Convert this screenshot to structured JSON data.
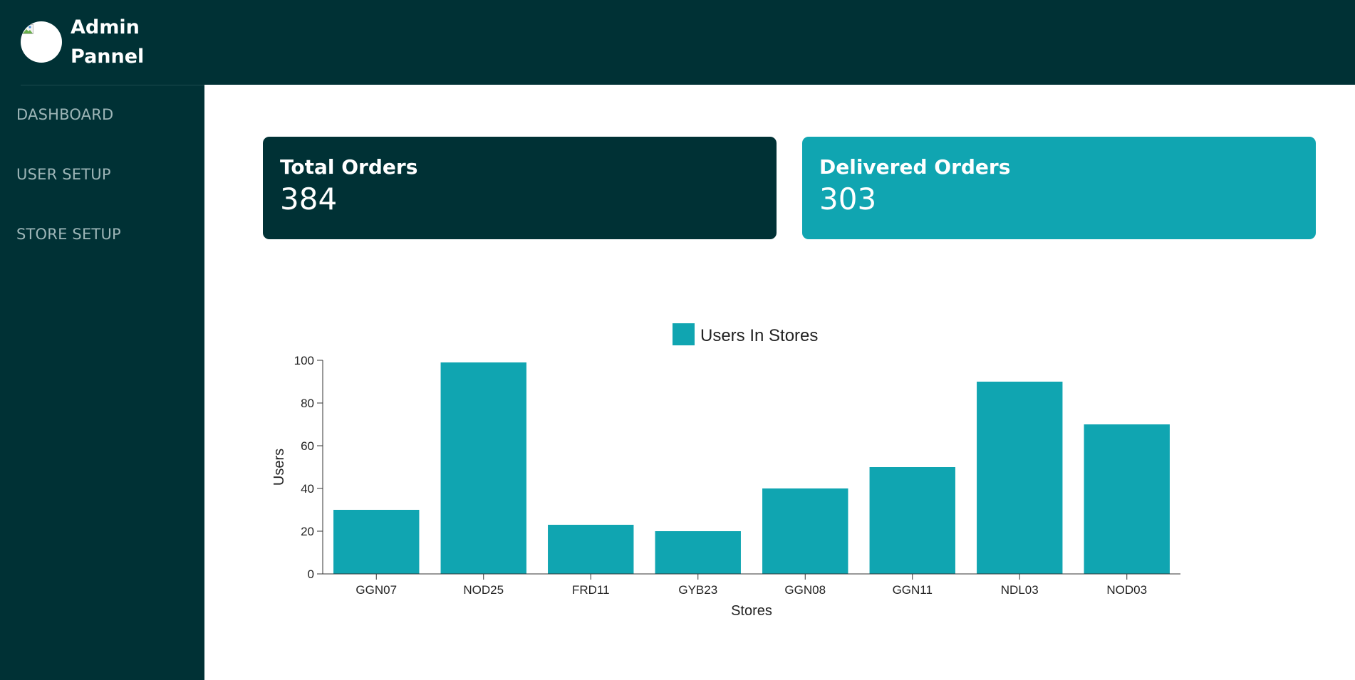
{
  "header": {
    "brand_line1": "Admin",
    "brand_line2": "Pannel",
    "bg_color": "#003135"
  },
  "sidebar": {
    "items": [
      {
        "label": "DASHBOARD"
      },
      {
        "label": "USER SETUP"
      },
      {
        "label": "STORE SETUP"
      }
    ]
  },
  "cards": {
    "total_orders": {
      "title": "Total Orders",
      "value": "384",
      "color": "#003135"
    },
    "delivered_orders": {
      "title": "Delivered Orders",
      "value": "303",
      "color": "#10a5b1"
    }
  },
  "chart_data": {
    "type": "bar",
    "categories": [
      "GGN07",
      "NOD25",
      "FRD11",
      "GYB23",
      "GGN08",
      "GGN11",
      "NDL03",
      "NOD03"
    ],
    "series": [
      {
        "name": "Users In Stores",
        "values": [
          30,
          99,
          23,
          20,
          40,
          50,
          90,
          70
        ],
        "color": "#10a5b1"
      }
    ],
    "xlabel": "Stores",
    "ylabel": "Users",
    "ylim": [
      0,
      100
    ],
    "yticks": [
      0,
      20,
      40,
      60,
      80,
      100
    ],
    "legend_position": "top-center",
    "grid": false
  }
}
